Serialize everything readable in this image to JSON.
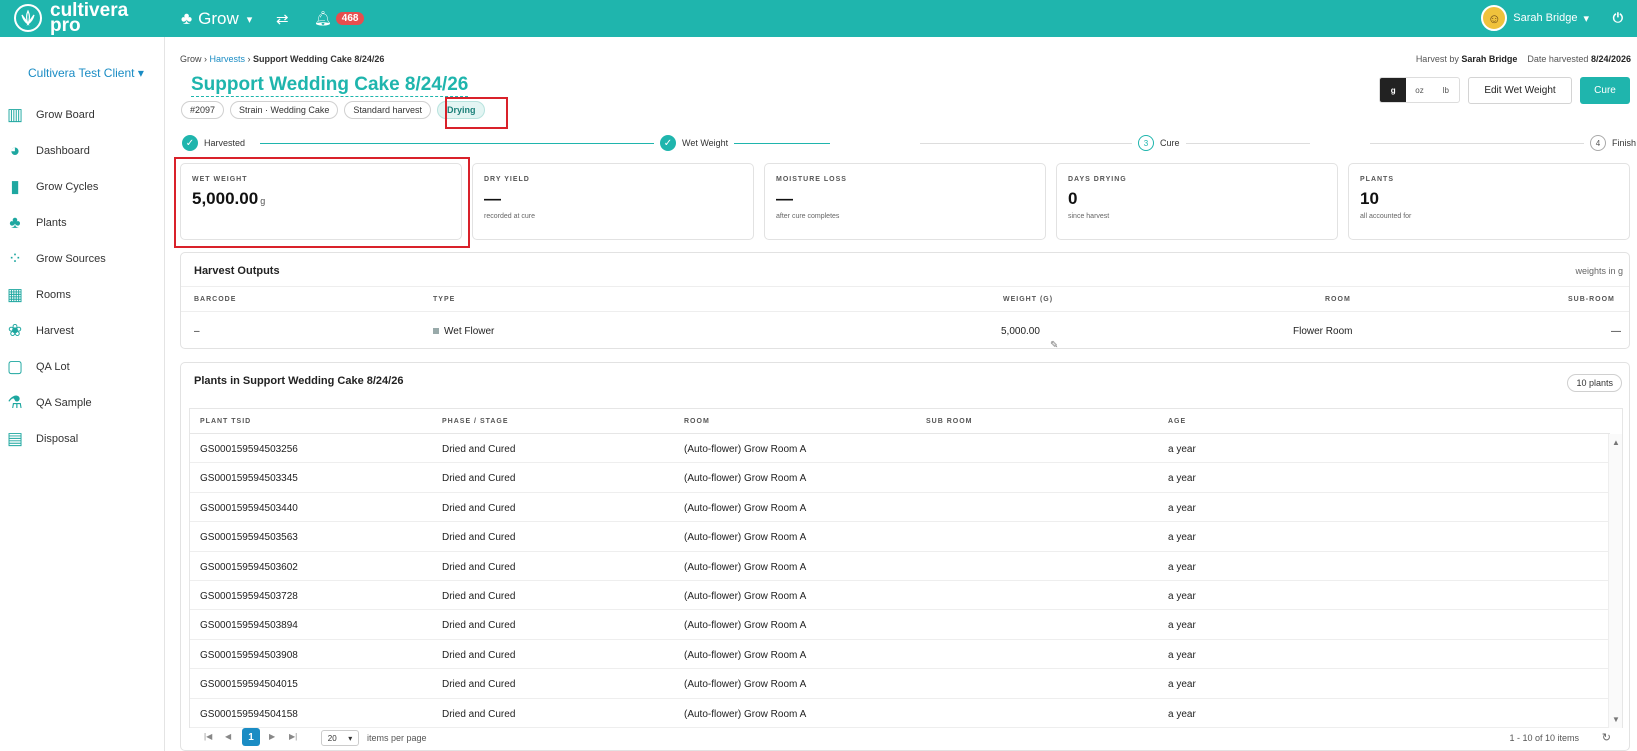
{
  "app": {
    "brand_line1": "cultivera",
    "brand_line2": "pro",
    "grow_menu": "Grow",
    "notifications": "468",
    "user": "Sarah Bridge"
  },
  "sidebar": {
    "client": "Cultivera Test Client",
    "items": [
      {
        "label": "Grow Board",
        "icon": "board-icon"
      },
      {
        "label": "Dashboard",
        "icon": "pie-chart-icon"
      },
      {
        "label": "Grow Cycles",
        "icon": "bar-chart-icon"
      },
      {
        "label": "Plants",
        "icon": "tree-icon"
      },
      {
        "label": "Grow Sources",
        "icon": "seeds-icon"
      },
      {
        "label": "Rooms",
        "icon": "rooms-icon"
      },
      {
        "label": "Harvest",
        "icon": "harvest-icon"
      },
      {
        "label": "QA Lot",
        "icon": "qa-lot-icon"
      },
      {
        "label": "QA Sample",
        "icon": "flask-icon"
      },
      {
        "label": "Disposal",
        "icon": "trash-icon"
      }
    ]
  },
  "breadcrumb": {
    "grow": "Grow",
    "harvests": "Harvests",
    "current": "Support Wedding Cake 8/24/26"
  },
  "page": {
    "title": "Support Wedding Cake 8/24/26",
    "tags": {
      "id": "#2097",
      "strain": "Strain · Wedding Cake",
      "type": "Standard harvest",
      "status": "Drying"
    },
    "harvest_by_label": "Harvest by",
    "harvest_by": "Sarah Bridge",
    "date_label": "Date harvested",
    "date": "8/24/2026"
  },
  "units": {
    "g": "g",
    "oz": "oz",
    "lb": "lb"
  },
  "actions": {
    "edit": "Edit Wet Weight",
    "cure": "Cure"
  },
  "stepper": {
    "s1": "Harvested",
    "s2": "Wet Weight",
    "s3_num": "3",
    "s3": "Cure",
    "s4_num": "4",
    "s4": "Finish"
  },
  "cards": {
    "wet": {
      "label": "WET WEIGHT",
      "value": "5,000.00",
      "unit": "g"
    },
    "dry": {
      "label": "DRY YIELD",
      "value": "—",
      "sub": "recorded at cure"
    },
    "moist": {
      "label": "MOISTURE LOSS",
      "value": "—",
      "sub": "after cure completes"
    },
    "days": {
      "label": "DAYS DRYING",
      "value": "0",
      "sub": "since harvest"
    },
    "plants": {
      "label": "PLANTS",
      "value": "10",
      "sub": "all accounted for"
    }
  },
  "outputs": {
    "title": "Harvest Outputs",
    "note": "weights in g",
    "headers": {
      "barcode": "BARCODE",
      "type": "TYPE",
      "weight": "WEIGHT (G)",
      "room": "ROOM",
      "subroom": "SUB-ROOM"
    },
    "row": {
      "barcode": "–",
      "type": "Wet Flower",
      "weight": "5,000.00",
      "room": "Flower Room",
      "subroom": "—"
    }
  },
  "plants": {
    "title": "Plants in Support Wedding Cake 8/24/26",
    "count": "10 plants",
    "headers": {
      "tsid": "PLANT TSID",
      "phase": "PHASE / STAGE",
      "room": "ROOM",
      "subroom": "SUB ROOM",
      "age": "AGE"
    },
    "rows": [
      {
        "tsid": "GS000159594503256",
        "phase": "Dried and Cured",
        "room": "(Auto-flower) Grow Room A",
        "subroom": "",
        "age": "a year"
      },
      {
        "tsid": "GS000159594503345",
        "phase": "Dried and Cured",
        "room": "(Auto-flower) Grow Room A",
        "subroom": "",
        "age": "a year"
      },
      {
        "tsid": "GS000159594503440",
        "phase": "Dried and Cured",
        "room": "(Auto-flower) Grow Room A",
        "subroom": "",
        "age": "a year"
      },
      {
        "tsid": "GS000159594503563",
        "phase": "Dried and Cured",
        "room": "(Auto-flower) Grow Room A",
        "subroom": "",
        "age": "a year"
      },
      {
        "tsid": "GS000159594503602",
        "phase": "Dried and Cured",
        "room": "(Auto-flower) Grow Room A",
        "subroom": "",
        "age": "a year"
      },
      {
        "tsid": "GS000159594503728",
        "phase": "Dried and Cured",
        "room": "(Auto-flower) Grow Room A",
        "subroom": "",
        "age": "a year"
      },
      {
        "tsid": "GS000159594503894",
        "phase": "Dried and Cured",
        "room": "(Auto-flower) Grow Room A",
        "subroom": "",
        "age": "a year"
      },
      {
        "tsid": "GS000159594503908",
        "phase": "Dried and Cured",
        "room": "(Auto-flower) Grow Room A",
        "subroom": "",
        "age": "a year"
      },
      {
        "tsid": "GS000159594504015",
        "phase": "Dried and Cured",
        "room": "(Auto-flower) Grow Room A",
        "subroom": "",
        "age": "a year"
      },
      {
        "tsid": "GS000159594504158",
        "phase": "Dried and Cured",
        "room": "(Auto-flower) Grow Room A",
        "subroom": "",
        "age": "a year"
      }
    ]
  },
  "pager": {
    "page": "1",
    "per_page": "20",
    "per_page_label": "items per page",
    "info": "1 - 10 of 10 items"
  },
  "colors": {
    "accent": "#1fb5ad",
    "link": "#1a8cc4",
    "badge": "#e84e4e",
    "highlight": "#d9212a"
  }
}
